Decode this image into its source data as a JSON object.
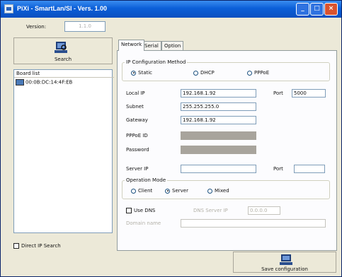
{
  "window": {
    "title": "PiXi - SmartLan/SI - Vers. 1.00"
  },
  "left": {
    "version_label": "Version:",
    "version_value": "1.1.0",
    "search_button": "Search",
    "device_list_header": "Board list",
    "devices": [
      "00:0B:DC:14:4F:EB"
    ],
    "direct_ip_label": "Direct IP Search"
  },
  "tabs": [
    "Network",
    "Serial",
    "Option"
  ],
  "network": {
    "ip_config_title": "IP Configuration Method",
    "ip_methods": [
      "Static",
      "DHCP",
      "PPPoE"
    ],
    "local_ip_label": "Local IP",
    "local_ip": "192.168.1.92",
    "port_label": "Port",
    "port": "5000",
    "subnet_label": "Subnet",
    "subnet": "255.255.255.0",
    "gateway_label": "Gateway",
    "gateway": "192.168.1.92",
    "pppoe_id_label": "PPPoE ID",
    "password_label": "Password",
    "server_ip_label": "Server IP",
    "server_port_label": "Port",
    "operation_title": "Operation Mode",
    "operation_modes": [
      "Client",
      "Server",
      "Mixed"
    ],
    "use_dns_label": "Use DNS",
    "dns_server_ip_label": "DNS Server IP",
    "dns_server_ip_value": "0.0.0.0",
    "domain_name_label": "Domain name"
  },
  "save_button": "Save configuration",
  "colors": {
    "titlebar": "#0b5fd8",
    "face": "#ece9d8",
    "disabled_field": "#a8a49c"
  }
}
